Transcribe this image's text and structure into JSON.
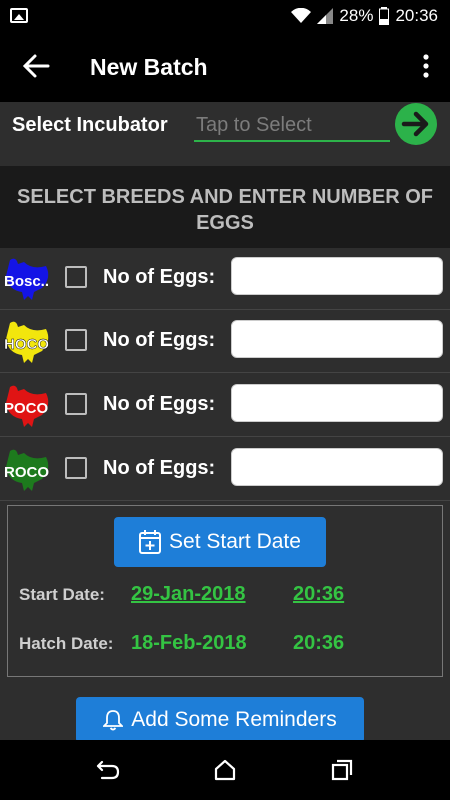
{
  "status": {
    "battery": "28%",
    "time": "20:36"
  },
  "appbar": {
    "title": "New Batch"
  },
  "incubator": {
    "label": "Select Incubator",
    "placeholder": "Tap to Select"
  },
  "section": {
    "heading": "SELECT BREEDS AND ENTER NUMBER OF EGGS"
  },
  "breeds": [
    {
      "badge": "Bosc..",
      "color": "#1414e6",
      "eggs_label": "No of Eggs:"
    },
    {
      "badge": "HOCO",
      "color": "#f2e60d",
      "eggs_label": "No of Eggs:"
    },
    {
      "badge": "POCO",
      "color": "#e01414",
      "eggs_label": "No of Eggs:"
    },
    {
      "badge": "ROCO",
      "color": "#1d7a1d",
      "eggs_label": "No of Eggs:"
    }
  ],
  "dates": {
    "set_start_label": "Set Start Date",
    "start_label": "Start Date:",
    "start_date": "29-Jan-2018",
    "start_time": "20:36",
    "hatch_label": "Hatch Date:",
    "hatch_date": "18-Feb-2018",
    "hatch_time": "20:36"
  },
  "reminders": {
    "label": "Add Some Reminders"
  },
  "colors": {
    "accent_green": "#34c443",
    "button_blue": "#1e7ed8"
  }
}
